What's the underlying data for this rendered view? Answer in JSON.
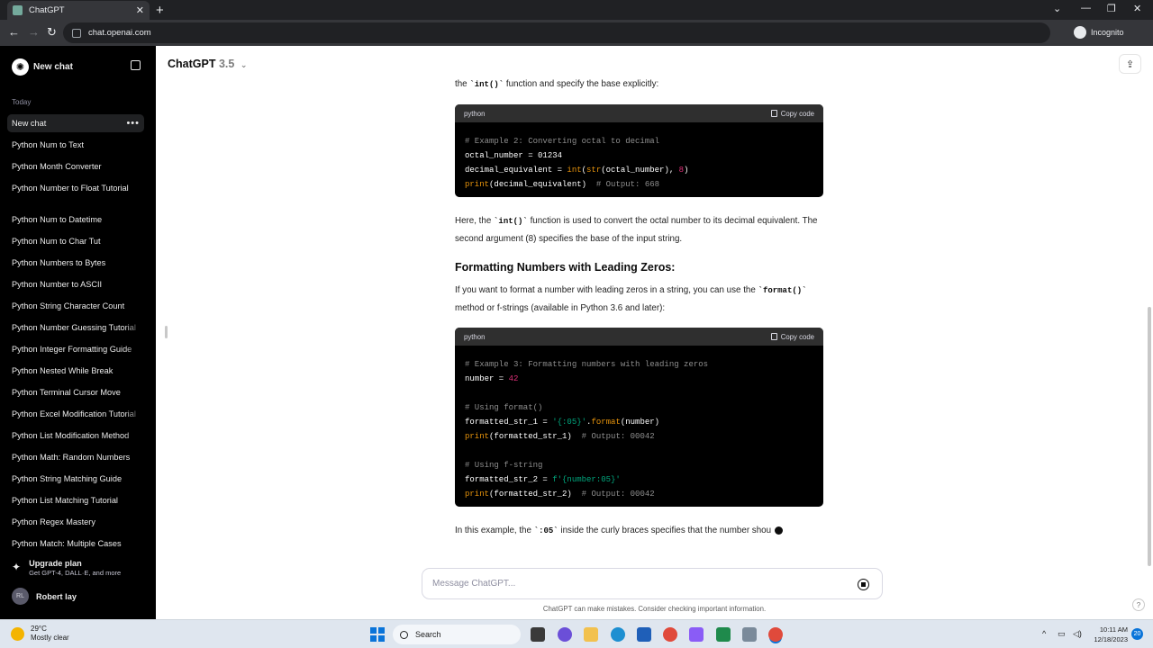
{
  "browser": {
    "tab_title": "ChatGPT",
    "tab_close": "✕",
    "new_tab": "+",
    "url": "chat.openai.com",
    "incognito_label": "Incognito",
    "nav": {
      "back": "←",
      "forward": "→",
      "reload": "↻"
    },
    "win": {
      "menu": "⌄",
      "min": "—",
      "max": "❐",
      "close": "✕"
    }
  },
  "sidebar": {
    "new_chat": "New chat",
    "section_today": "Today",
    "active_item": "New chat",
    "items": [
      "Python Num to Text",
      "Python Month Converter",
      "Python Number to Float Tutorial",
      "Python Num to Datetime",
      "Python Num to Char Tut",
      "Python Numbers to Bytes",
      "Python Number to ASCII",
      "Python String Character Count",
      "Python Number Guessing Tutorial",
      "Python Integer Formatting Guide",
      "Python Nested While Break",
      "Python Terminal Cursor Move",
      "Python Excel Modification Tutorial",
      "Python List Modification Method",
      "Python Math: Random Numbers",
      "Python String Matching Guide",
      "Python List Matching Tutorial",
      "Python Regex Mastery",
      "Python Match: Multiple Cases"
    ],
    "upgrade_title": "Upgrade plan",
    "upgrade_sub": "Get GPT-4, DALL·E, and more",
    "user_initials": "RL",
    "user_name": "Robert lay"
  },
  "header": {
    "model_name": "ChatGPT",
    "model_version": "3.5"
  },
  "content": {
    "intro_pre": "the ",
    "intro_code": "`int()`",
    "intro_post": " function and specify the base explicitly:",
    "code1": {
      "lang": "python",
      "copy": "Copy code",
      "l1": "# Example 2: Converting octal to decimal",
      "l2": "octal_number = 01234",
      "l3a": "decimal_equivalent = ",
      "l3b": "int",
      "l3c": "(",
      "l3d": "str",
      "l3e": "(octal_number), ",
      "l3f": "8",
      "l3g": ")",
      "l4a": "print",
      "l4b": "(decimal_equivalent)  ",
      "l4c": "# Output: 668"
    },
    "p2_pre": "Here, the ",
    "p2_code": "`int()`",
    "p2_post": " function is used to convert the octal number to its decimal equivalent. The second argument (8) specifies the base of the input string.",
    "heading": "Formatting Numbers with Leading Zeros:",
    "p3_pre": "If you want to format a number with leading zeros in a string, you can use the ",
    "p3_code": "`format()`",
    "p3_post": " method or f-strings (available in Python 3.6 and later):",
    "code2": {
      "lang": "python",
      "copy": "Copy code",
      "l1": "# Example 3: Formatting numbers with leading zeros",
      "l2a": "number = ",
      "l2b": "42",
      "l4": "# Using format()",
      "l5a": "formatted_str_1 = ",
      "l5b": "'{:05}'",
      "l5c": ".",
      "l5d": "format",
      "l5e": "(number)",
      "l6a": "print",
      "l6b": "(formatted_str_1)  ",
      "l6c": "# Output: 00042",
      "l8": "# Using f-string",
      "l9a": "formatted_str_2 = ",
      "l9b": "f'{number:05}'",
      "l10a": "print",
      "l10b": "(formatted_str_2)  ",
      "l10c": "# Output: 00042"
    },
    "p4_pre": "In this example, the ",
    "p4_code": "`:05`",
    "p4_post": " inside the curly braces specifies that the number shou"
  },
  "composer": {
    "placeholder": "Message ChatGPT...",
    "disclaimer": "ChatGPT can make mistakes. Consider checking important information.",
    "help": "?"
  },
  "taskbar": {
    "temp": "29°C",
    "weather": "Mostly clear",
    "search": "Search",
    "time": "10:11 AM",
    "date": "12/18/2023",
    "notifications": "20"
  }
}
